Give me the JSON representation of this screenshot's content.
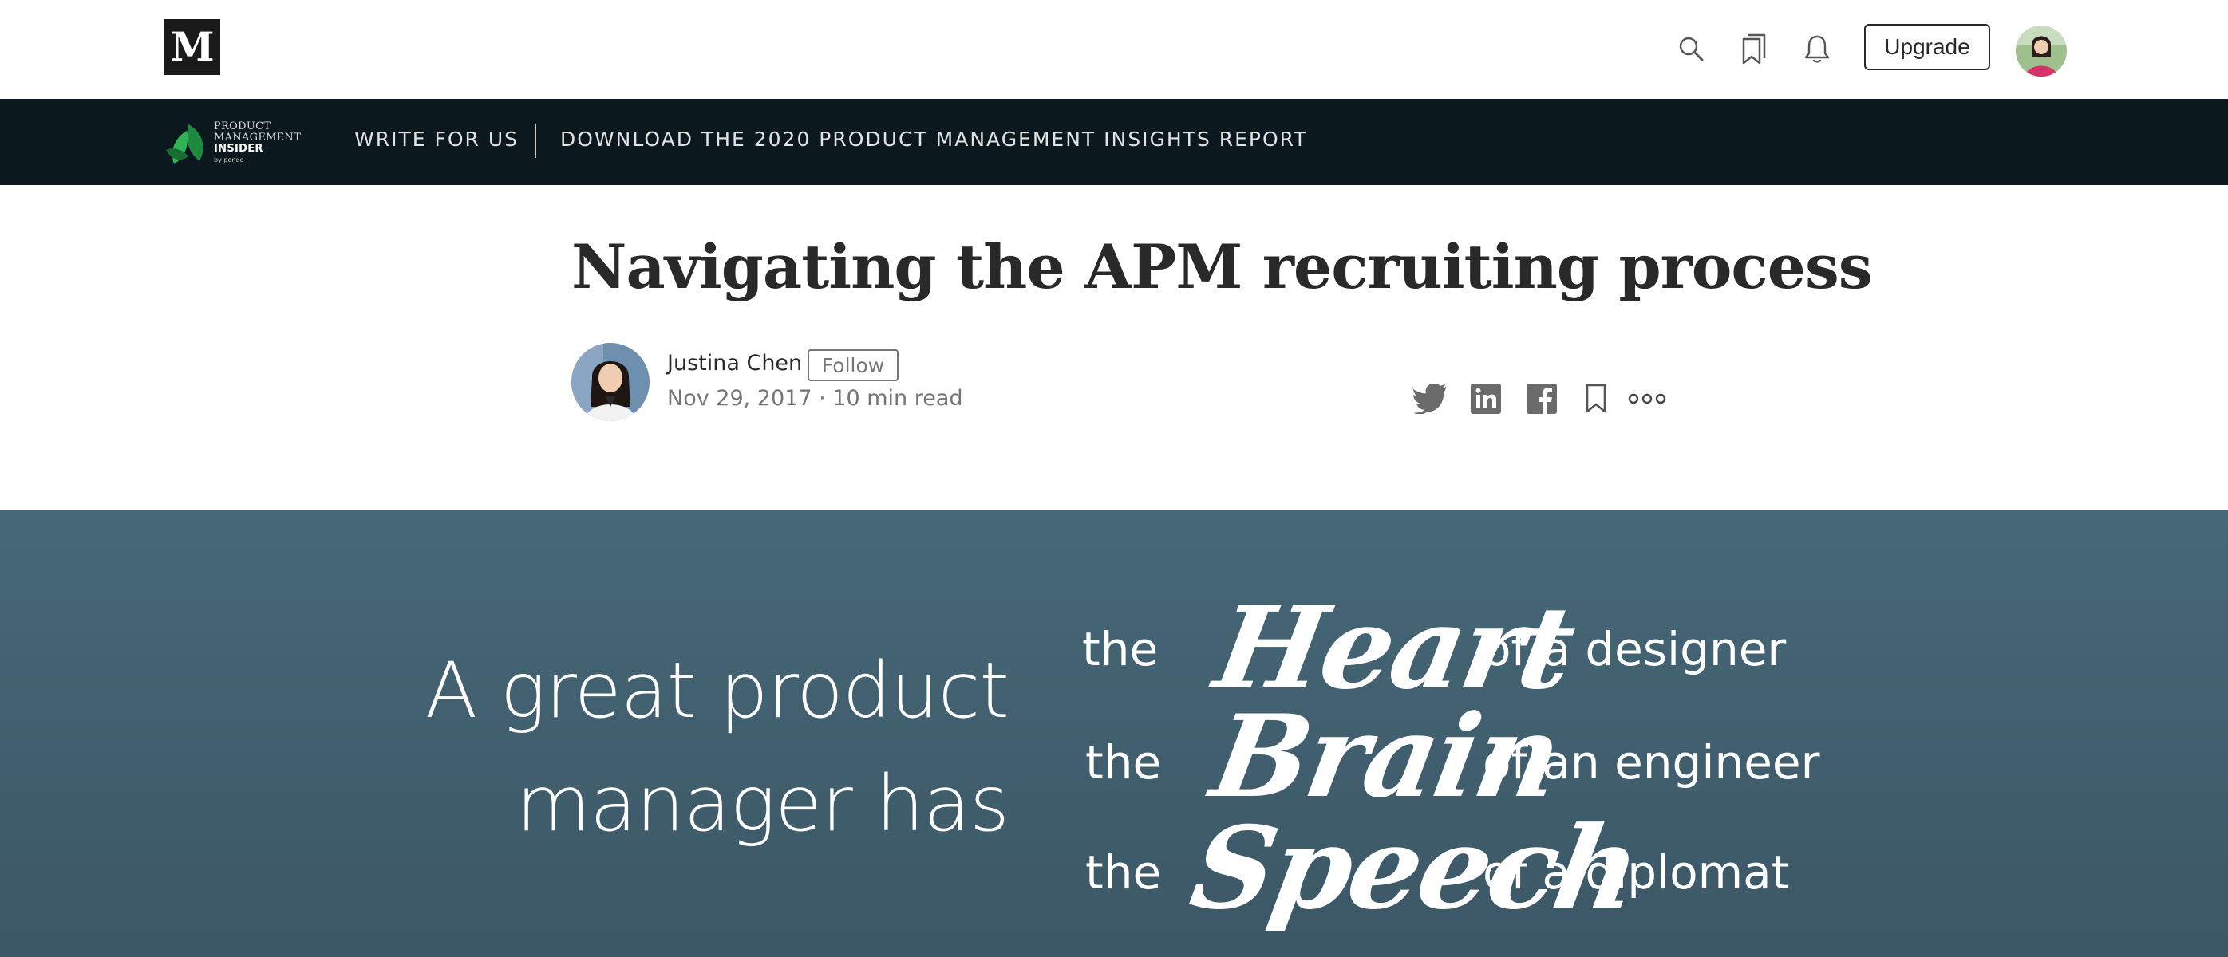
{
  "topbar": {
    "logo_letter": "M",
    "upgrade_label": "Upgrade",
    "icons": [
      "search-icon",
      "bookmarks-icon",
      "bell-icon"
    ]
  },
  "publication": {
    "logo_line1": "PRODUCT",
    "logo_line2": "MANAGEMENT",
    "logo_line3": "INSIDER",
    "logo_sub": "by pendo",
    "nav": [
      {
        "label": "WRITE FOR US"
      },
      {
        "label": "DOWNLOAD THE 2020 PRODUCT MANAGEMENT INSIGHTS REPORT"
      }
    ]
  },
  "article": {
    "title": "Navigating the APM recruiting process",
    "author": "Justina Chen",
    "follow_label": "Follow",
    "meta": "Nov 29, 2017 · 10 min read",
    "share_icons": [
      "twitter-icon",
      "linkedin-icon",
      "facebook-icon",
      "bookmark-icon",
      "more-icon"
    ]
  },
  "hero": {
    "lead_line1": "A great product",
    "lead_line2": "manager has",
    "rows": [
      {
        "the": "the",
        "word": "Heart",
        "of": "of a designer"
      },
      {
        "the": "the",
        "word": "Brain",
        "of": "of an engineer"
      },
      {
        "the": "the",
        "word": "Speech",
        "of": "of a diplomat"
      }
    ],
    "background_color": "#466877"
  },
  "colors": {
    "pubbar": "#0b191e",
    "text": "#292929",
    "muted": "#757575"
  }
}
